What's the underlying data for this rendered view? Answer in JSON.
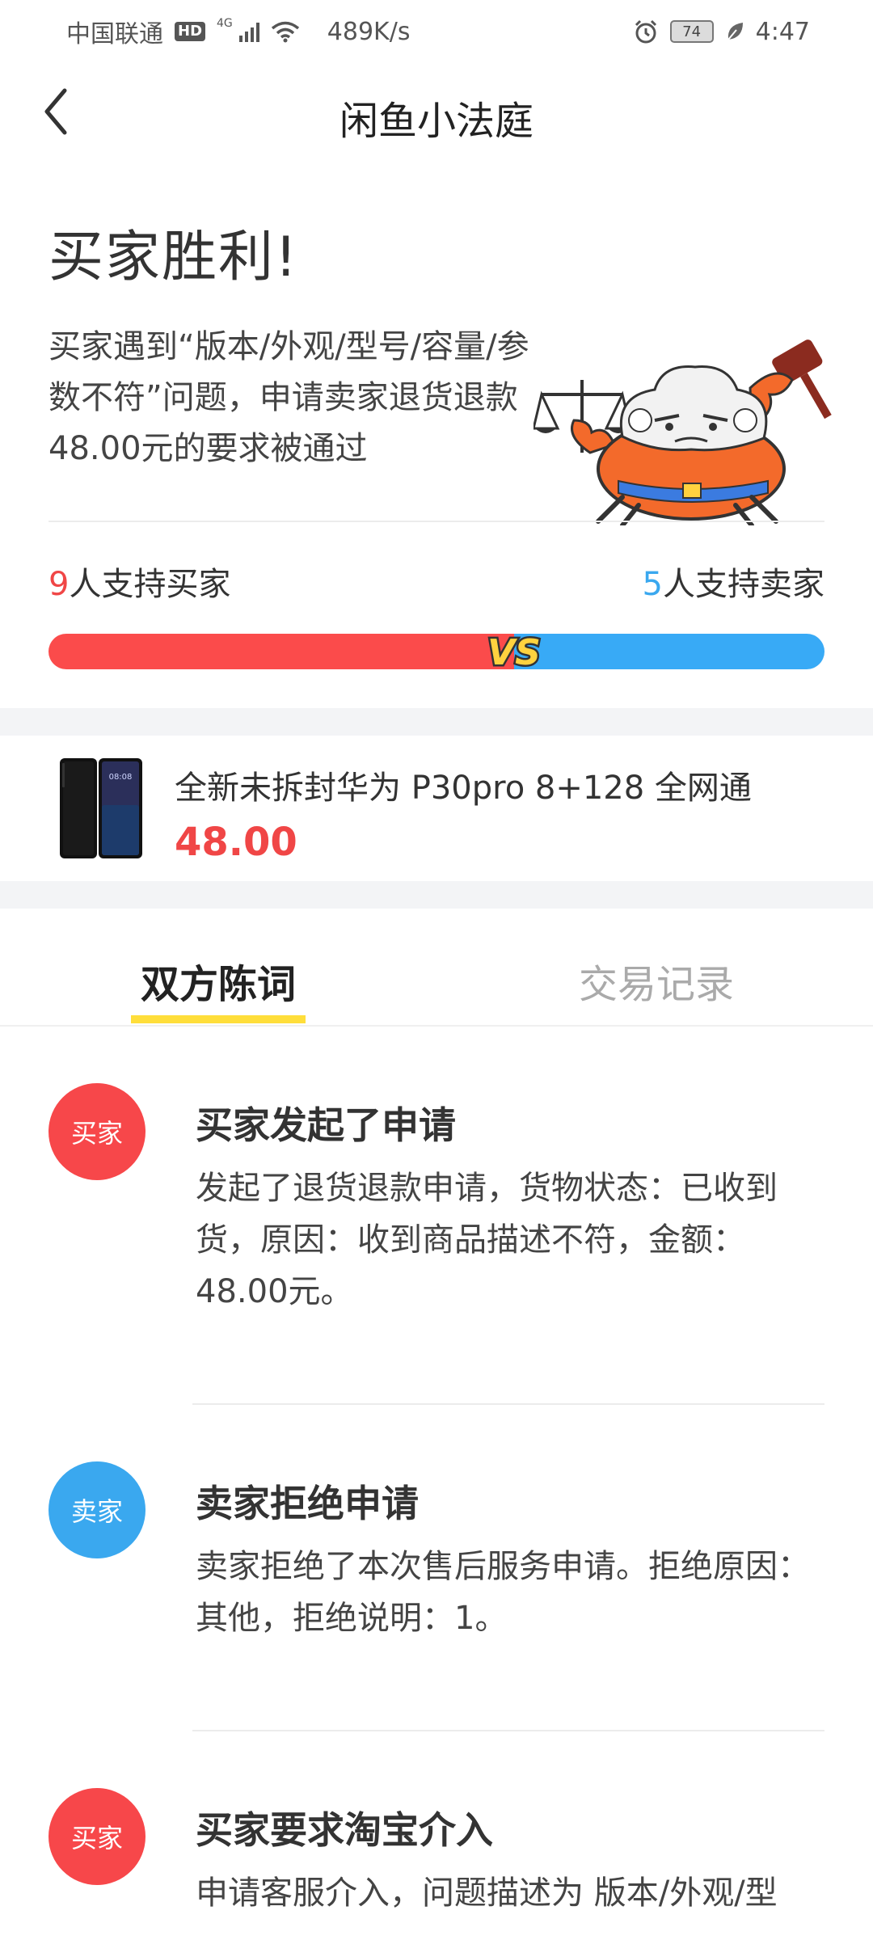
{
  "status_bar": {
    "carrier": "中国联通",
    "hd": "HD",
    "network": "4G",
    "speed": "489K/s",
    "battery": "74",
    "time": "4:47"
  },
  "nav": {
    "title": "闲鱼小法庭",
    "back_icon": "chevron-left-icon"
  },
  "result": {
    "title": "买家胜利!",
    "description": "买家遇到“版本/外观/型号/容量/参数不符”问题，申请卖家退货退款48.00元的要求被通过"
  },
  "support": {
    "buyer_count": "9",
    "buyer_label": "人支持买家",
    "seller_count": "5",
    "seller_label": "人支持卖家",
    "buyer_fraction": 0.6,
    "vs_text": "VS"
  },
  "product": {
    "title": "全新未拆封华为 P30pro 8+128 全网通",
    "price": "48.00",
    "thumb_time": "08:08"
  },
  "tabs": [
    {
      "label": "双方陈词",
      "active": true
    },
    {
      "label": "交易记录",
      "active": false
    }
  ],
  "timeline": [
    {
      "role": "买家",
      "title": "买家发起了申请",
      "text": "发起了退货退款申请，货物状态：已收到货，原因：收到商品描述不符，金额：48.00元。"
    },
    {
      "role": "卖家",
      "title": "卖家拒绝申请",
      "text": "卖家拒绝了本次售后服务申请。拒绝原因：其他，拒绝说明：1。"
    },
    {
      "role": "买家",
      "title": "买家要求淘宝介入",
      "text": "申请客服介入，问题描述为 版本/外观/型"
    }
  ],
  "colors": {
    "buyer_red": "#f04646",
    "seller_blue": "#3aa8ef",
    "tab_accent": "#ffde3a"
  }
}
